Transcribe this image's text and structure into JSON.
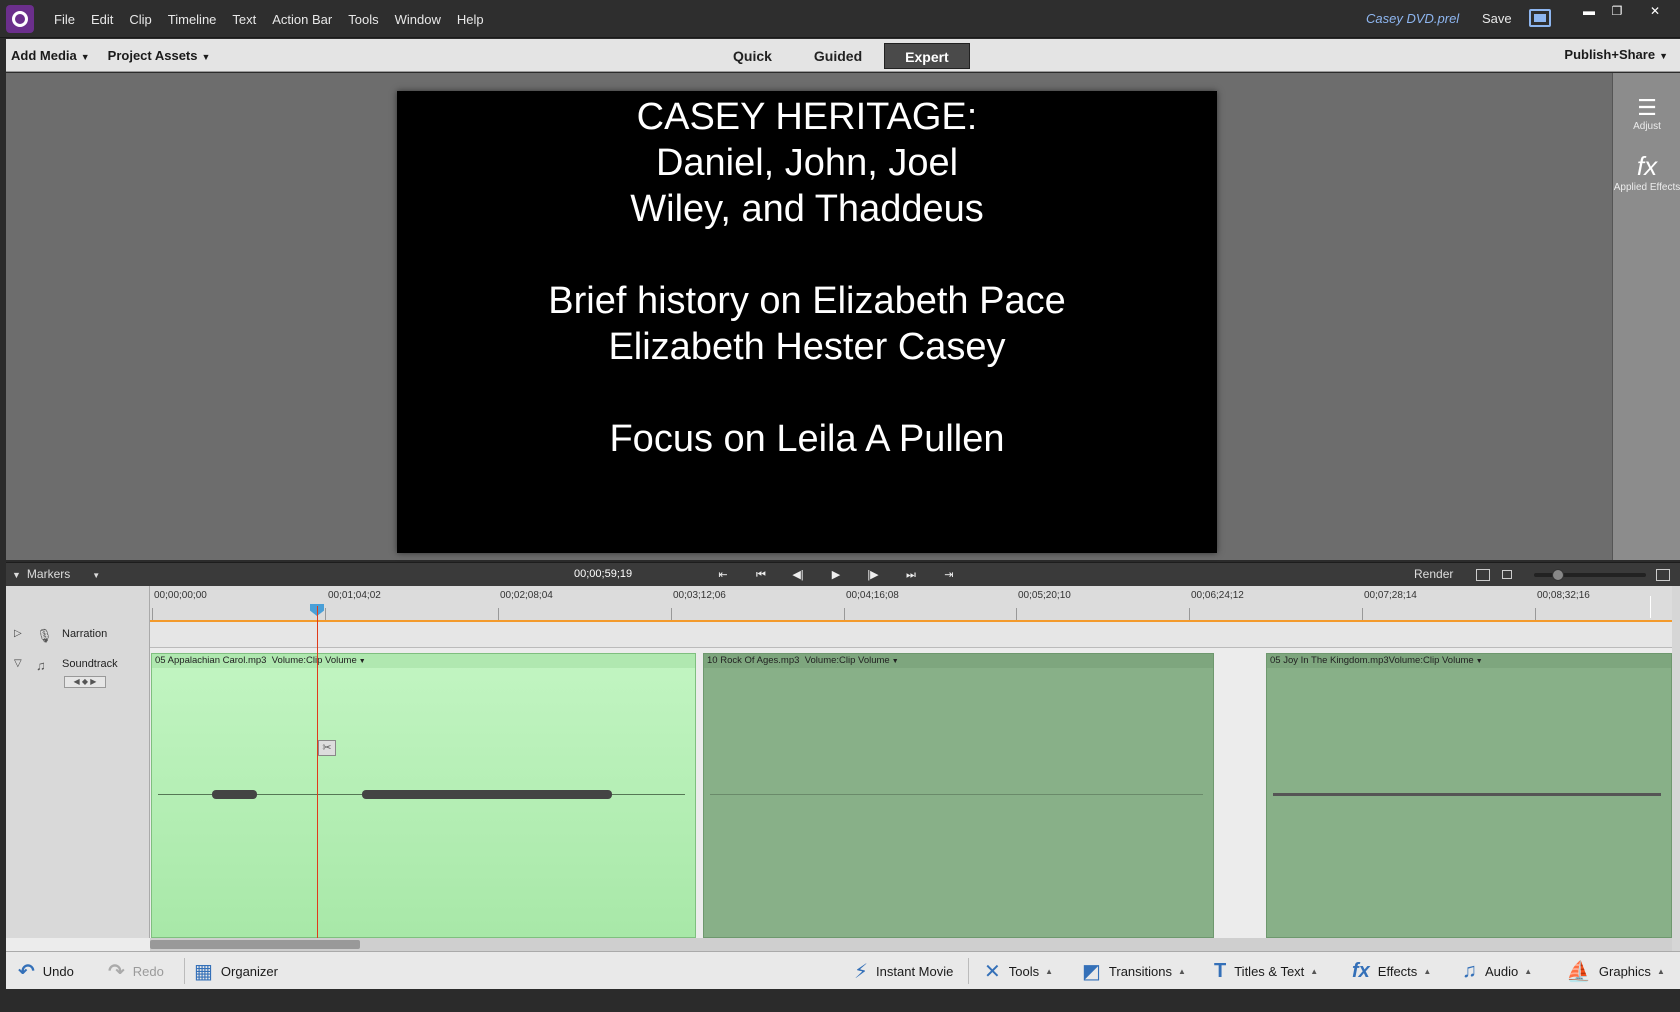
{
  "app": {
    "menu": [
      "File",
      "Edit",
      "Clip",
      "Timeline",
      "Text",
      "Action Bar",
      "Tools",
      "Window",
      "Help"
    ],
    "file_name": "Casey DVD.prel",
    "save_label": "Save",
    "window_controls": {
      "minimize": "▬",
      "restore": "❐",
      "close": "✕"
    }
  },
  "modebar": {
    "add_media": "Add Media",
    "project_assets": "Project Assets",
    "tabs": [
      "Quick",
      "Guided",
      "Expert"
    ],
    "active_tab": "Expert",
    "publish": "Publish+Share"
  },
  "preview": {
    "lines": [
      "CASEY HERITAGE:",
      "Daniel, John, Joel",
      "Wiley, and Thaddeus",
      "",
      "Brief history on Elizabeth Pace",
      "Elizabeth Hester Casey",
      "",
      "Focus on Leila A Pullen"
    ]
  },
  "right_panel": {
    "adjust": "Adjust",
    "applied_effects": "Applied Effects",
    "adjust_icon": "sliders-icon",
    "fx_icon": "fx-icon"
  },
  "transport": {
    "markers_label": "Markers",
    "timecode": "00;00;59;19",
    "render_label": "Render",
    "buttons": [
      "go-to-start",
      "previous-edit",
      "step-back",
      "play",
      "step-forward",
      "next-edit",
      "go-to-end"
    ]
  },
  "timeline": {
    "ruler": [
      "00;00;00;00",
      "00;01;04;02",
      "00;02;08;04",
      "00;03;12;06",
      "00;04;16;08",
      "00;05;20;10",
      "00;06;24;12",
      "00;07;28;14",
      "00;08;32;16"
    ],
    "tracks": {
      "narration": "Narration",
      "soundtrack": "Soundtrack"
    },
    "clips": [
      {
        "name": "05 Appalachian Carol.mp3",
        "volume": "Volume:Clip Volume",
        "color": "#b8f2b8"
      },
      {
        "name": "10 Rock Of Ages.mp3",
        "volume": "Volume:Clip Volume",
        "color": "#88b088"
      },
      {
        "name": "05 Joy In The Kingdom.mp3",
        "volume": "Volume:Clip Volume",
        "color": "#88b088"
      }
    ]
  },
  "actionbar": {
    "undo": "Undo",
    "redo": "Redo",
    "organizer": "Organizer",
    "instant_movie": "Instant Movie",
    "tools": "Tools",
    "transitions": "Transitions",
    "titles_text": "Titles & Text",
    "effects": "Effects",
    "audio": "Audio",
    "graphics": "Graphics"
  },
  "colors": {
    "accent": "#8eb6f0",
    "playhead": "#e03a1a",
    "ruler_highlight": "#f39a2c",
    "clip_selected": "#b8f2b8",
    "clip_unselected": "#88b088"
  }
}
